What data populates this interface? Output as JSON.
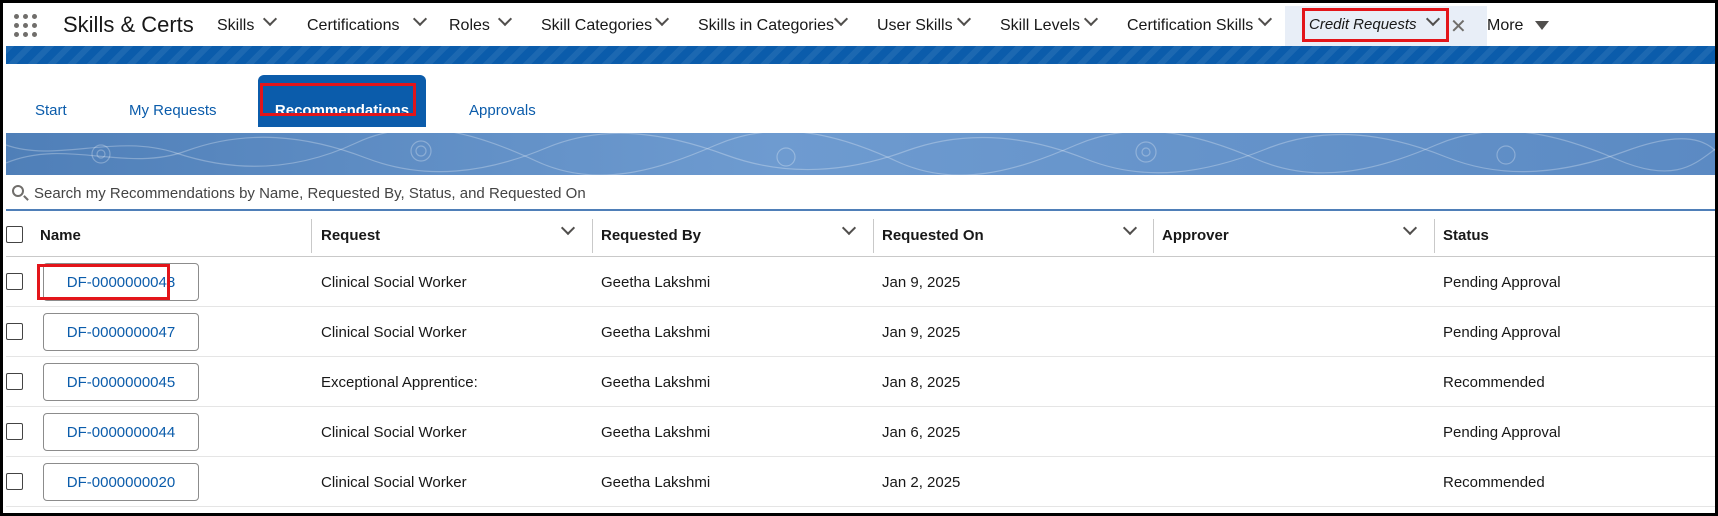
{
  "app": {
    "name": "Skills & Certs"
  },
  "nav": {
    "items": [
      {
        "label": "Skills"
      },
      {
        "label": "Certifications"
      },
      {
        "label": "Roles"
      },
      {
        "label": "Skill Categories"
      },
      {
        "label": "Skills in Categories"
      },
      {
        "label": "User Skills"
      },
      {
        "label": "Skill Levels"
      },
      {
        "label": "Certification Skills"
      }
    ],
    "active_tab": {
      "label": "Credit Requests"
    },
    "more_label": "More"
  },
  "subtabs": {
    "items": [
      {
        "label": "Start"
      },
      {
        "label": "My Requests"
      },
      {
        "label": "Recommendations"
      },
      {
        "label": "Approvals"
      }
    ],
    "active_index": 2
  },
  "search": {
    "placeholder": "Search my Recommendations by Name, Requested By, Status, and Requested On"
  },
  "table": {
    "columns": [
      {
        "label": "Name"
      },
      {
        "label": "Request"
      },
      {
        "label": "Requested By"
      },
      {
        "label": "Requested On"
      },
      {
        "label": "Approver"
      },
      {
        "label": "Status"
      }
    ],
    "rows": [
      {
        "name": "DF-0000000048",
        "request": "Clinical Social Worker",
        "requested_by": "Geetha Lakshmi",
        "requested_on": "Jan 9, 2025",
        "approver": "",
        "status": "Pending Approval"
      },
      {
        "name": "DF-0000000047",
        "request": "Clinical Social Worker",
        "requested_by": "Geetha Lakshmi",
        "requested_on": "Jan 9, 2025",
        "approver": "",
        "status": "Pending Approval"
      },
      {
        "name": "DF-0000000045",
        "request": "Exceptional Apprentice:",
        "requested_by": "Geetha Lakshmi",
        "requested_on": "Jan 8, 2025",
        "approver": "",
        "status": "Recommended"
      },
      {
        "name": "DF-0000000044",
        "request": "Clinical Social Worker",
        "requested_by": "Geetha Lakshmi",
        "requested_on": "Jan 6, 2025",
        "approver": "",
        "status": "Pending Approval"
      },
      {
        "name": "DF-0000000020",
        "request": "Clinical Social Worker",
        "requested_by": "Geetha Lakshmi",
        "requested_on": "Jan 2, 2025",
        "approver": "",
        "status": "Recommended"
      }
    ]
  },
  "colors": {
    "brand_blue": "#0b5cab",
    "highlight_red": "#e3151a",
    "banner_blue": "#5b8ac3"
  }
}
